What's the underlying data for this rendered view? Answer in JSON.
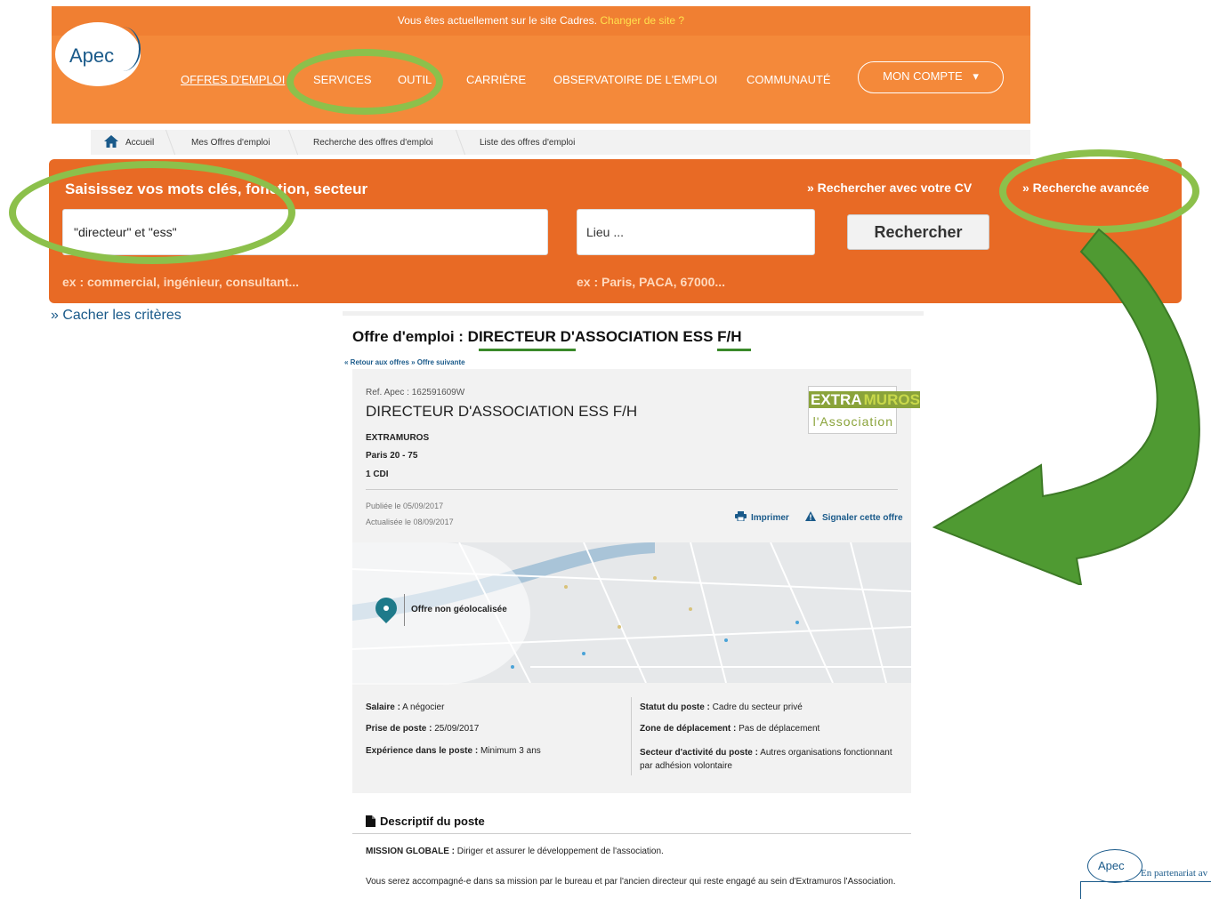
{
  "site_bar": {
    "text": "Vous êtes actuellement sur le site Cadres.",
    "link": "Changer de site ?"
  },
  "brand": {
    "logo_text": "Apec"
  },
  "nav": {
    "items": [
      "OFFRES D'EMPLOI",
      "SERVICES",
      "OUTIL",
      "CARRIÈRE",
      "OBSERVATOIRE DE L'EMPLOI",
      "COMMUNAUTÉ"
    ],
    "account": "MON COMPTE",
    "account_caret": "▾"
  },
  "breadcrumb": [
    "Accueil",
    "Mes Offres d'emploi",
    "Recherche des offres d'emploi",
    "Liste des offres d'emploi"
  ],
  "search": {
    "label": "Saisissez vos mots clés, fonction, secteur",
    "search_with_cv": "» Rechercher avec votre CV",
    "advanced_search": "» Recherche avancée",
    "keywords_value": "\"directeur\" et \"ess\"",
    "location_placeholder": "Lieu ...",
    "button": "Rechercher",
    "hint_keywords": "ex : commercial, ingénieur, consultant...",
    "hint_location": "ex : Paris, PACA, 67000..."
  },
  "hide_criteria": "» Cacher les critères",
  "offer": {
    "heading_prefix": "Offre d'emploi : ",
    "heading_word1": "DIRECTEUR",
    "heading_mid": " D'ASSOCIATION ",
    "heading_word2": "ESS",
    "heading_suffix": " F/H",
    "nav_links": "« Retour aux offres » Offre suivante",
    "ref": "Ref. Apec : 162591609W",
    "title": "DIRECTEUR D'ASSOCIATION ESS F/H",
    "company": "EXTRAMUROS",
    "location": "Paris 20 - 75",
    "contract": "1 CDI",
    "published": "Publiée le 05/09/2017",
    "updated": "Actualisée le 08/09/2017",
    "print": "Imprimer",
    "report": "Signaler cette offre",
    "company_logo_line1a": "EXTRA",
    "company_logo_line1b": "MUROS",
    "company_logo_line2": "l'Association",
    "map_label": "Offre non géolocalisée",
    "details_left": [
      {
        "label": "Salaire :",
        "value": "A négocier"
      },
      {
        "label": "Prise de poste :",
        "value": "25/09/2017"
      },
      {
        "label": "Expérience dans le poste :",
        "value": "Minimum 3 ans"
      }
    ],
    "details_right": [
      {
        "label": "Statut du poste :",
        "value": "Cadre du secteur privé"
      },
      {
        "label": "Zone de déplacement :",
        "value": "Pas de déplacement"
      },
      {
        "label": "Secteur d'activité du poste :",
        "value": "Autres organisations fonctionnant par adhésion volontaire"
      }
    ],
    "description_title": "Descriptif du poste",
    "mission_label": "MISSION GLOBALE :",
    "mission_text": "Diriger et assurer le développement de l'association.",
    "accompaniment": "Vous serez accompagné-e dans sa mission par le bureau et par l'ancien directeur qui reste engagé au sein d'Extramuros l'Association."
  },
  "partner": {
    "logo_text": "Apec",
    "text": "En partenariat av"
  },
  "colors": {
    "orange": "#f4893a",
    "annotation_green": "#8cc04b",
    "arrow_green": "#4f9a32",
    "link_blue": "#1a5a8a"
  }
}
